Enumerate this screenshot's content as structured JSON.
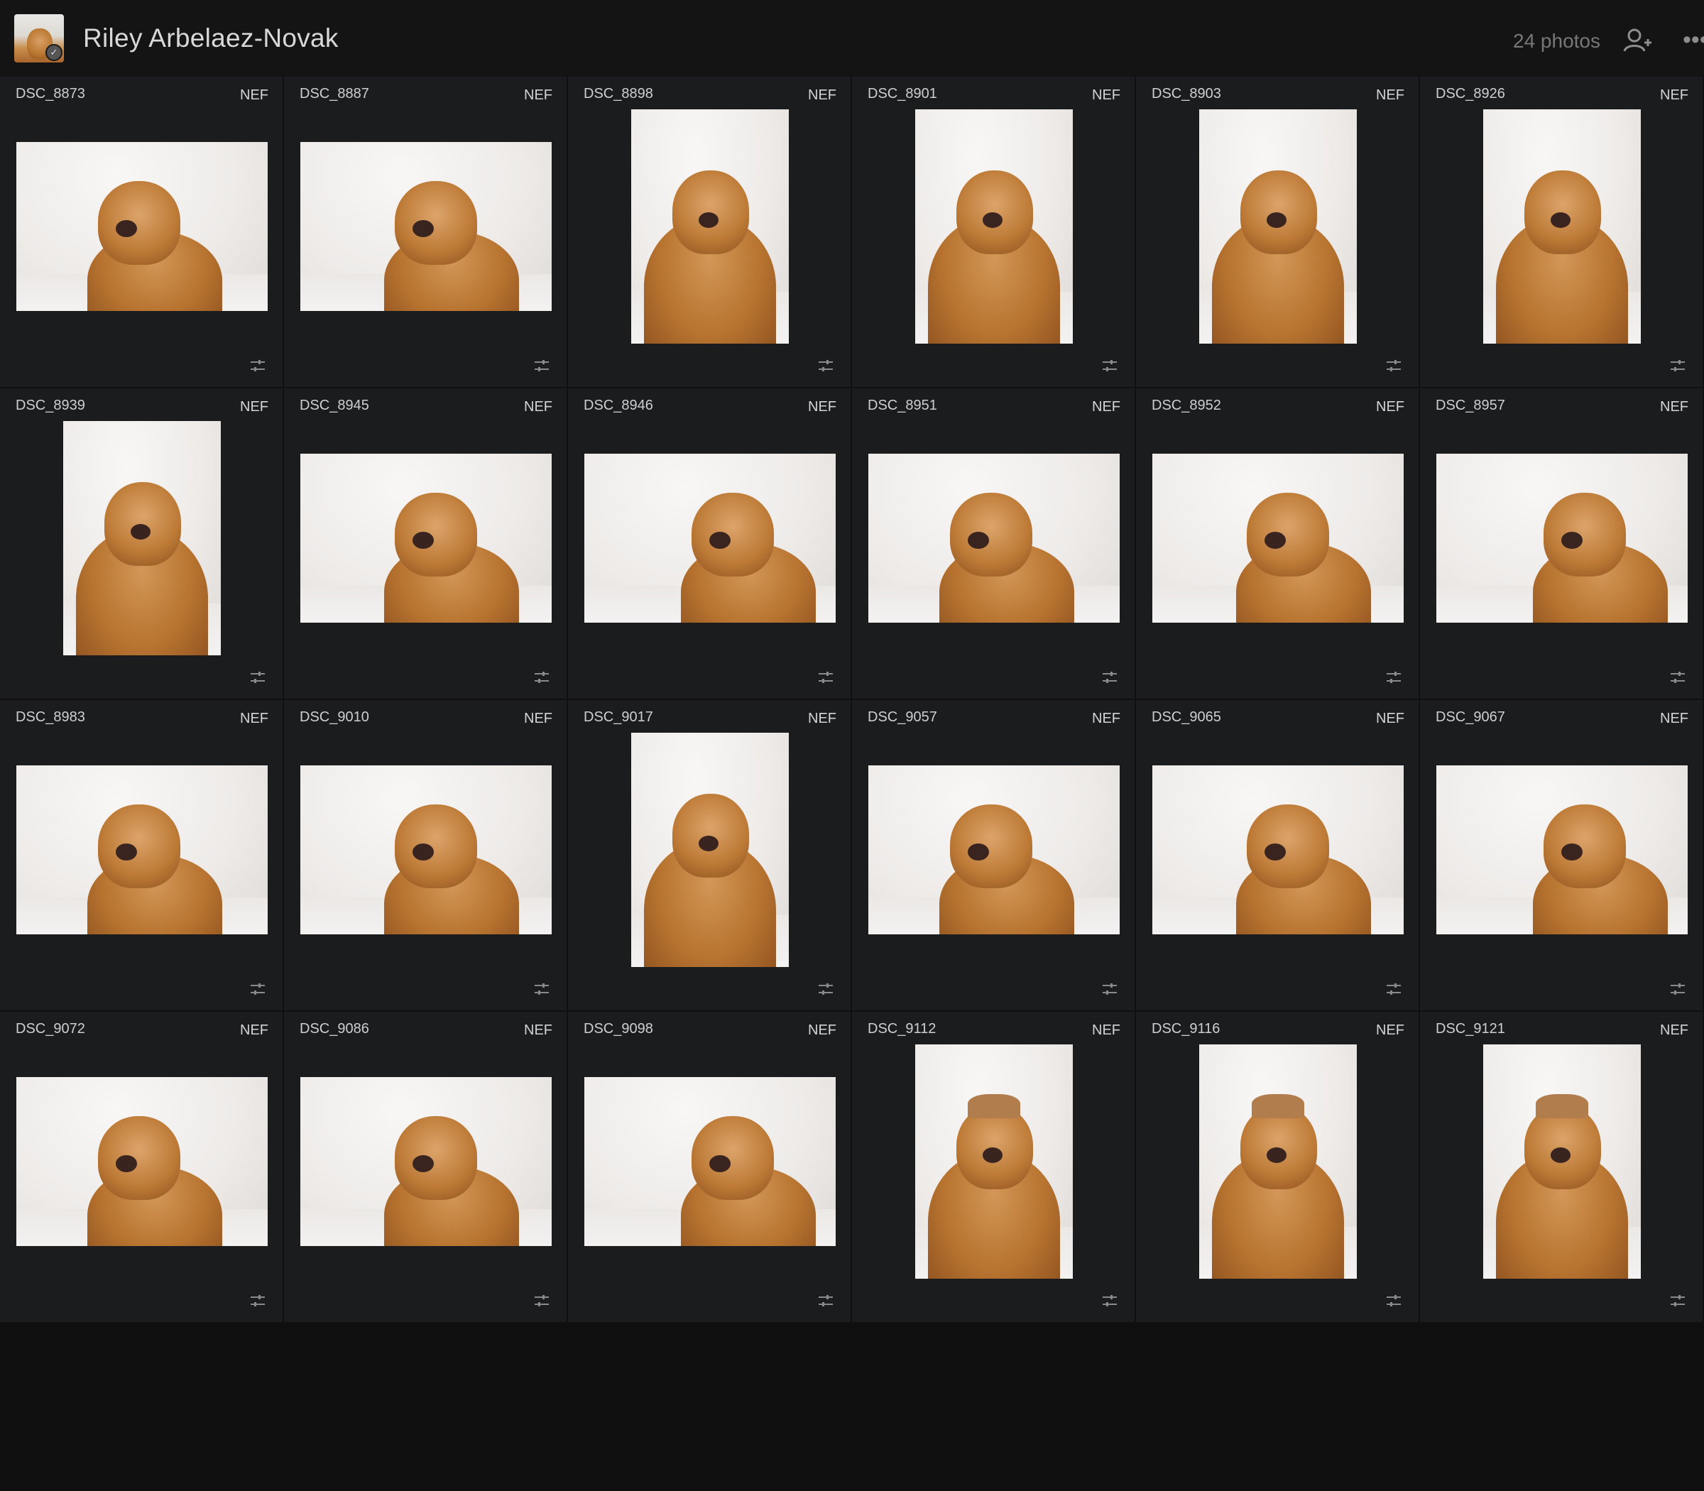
{
  "header": {
    "owner_name": "Riley Arbelaez-Novak",
    "photo_count": "24 photos",
    "more_label": "•••"
  },
  "colors": {
    "background": "#151516",
    "cell": "#1b1c1e",
    "text": "#d4d4d4",
    "muted": "#777777",
    "dog": "#b7732f"
  },
  "icons": {
    "share": "share-people-icon",
    "more": "more-icon",
    "adjust": "sliders-icon"
  },
  "photos": [
    {
      "filename": "DSC_8873",
      "format": "NEF",
      "orientation": "landscape"
    },
    {
      "filename": "DSC_8887",
      "format": "NEF",
      "orientation": "landscape"
    },
    {
      "filename": "DSC_8898",
      "format": "NEF",
      "orientation": "portrait"
    },
    {
      "filename": "DSC_8901",
      "format": "NEF",
      "orientation": "portrait"
    },
    {
      "filename": "DSC_8903",
      "format": "NEF",
      "orientation": "portrait"
    },
    {
      "filename": "DSC_8926",
      "format": "NEF",
      "orientation": "portrait"
    },
    {
      "filename": "DSC_8939",
      "format": "NEF",
      "orientation": "portrait"
    },
    {
      "filename": "DSC_8945",
      "format": "NEF",
      "orientation": "landscape"
    },
    {
      "filename": "DSC_8946",
      "format": "NEF",
      "orientation": "landscape"
    },
    {
      "filename": "DSC_8951",
      "format": "NEF",
      "orientation": "landscape"
    },
    {
      "filename": "DSC_8952",
      "format": "NEF",
      "orientation": "landscape"
    },
    {
      "filename": "DSC_8957",
      "format": "NEF",
      "orientation": "landscape"
    },
    {
      "filename": "DSC_8983",
      "format": "NEF",
      "orientation": "landscape"
    },
    {
      "filename": "DSC_9010",
      "format": "NEF",
      "orientation": "landscape"
    },
    {
      "filename": "DSC_9017",
      "format": "NEF",
      "orientation": "portrait"
    },
    {
      "filename": "DSC_9057",
      "format": "NEF",
      "orientation": "landscape"
    },
    {
      "filename": "DSC_9065",
      "format": "NEF",
      "orientation": "landscape"
    },
    {
      "filename": "DSC_9067",
      "format": "NEF",
      "orientation": "landscape"
    },
    {
      "filename": "DSC_9072",
      "format": "NEF",
      "orientation": "landscape"
    },
    {
      "filename": "DSC_9086",
      "format": "NEF",
      "orientation": "landscape"
    },
    {
      "filename": "DSC_9098",
      "format": "NEF",
      "orientation": "landscape"
    },
    {
      "filename": "DSC_9112",
      "format": "NEF",
      "orientation": "portrait",
      "hat": true
    },
    {
      "filename": "DSC_9116",
      "format": "NEF",
      "orientation": "portrait",
      "hat": true
    },
    {
      "filename": "DSC_9121",
      "format": "NEF",
      "orientation": "portrait",
      "hat": true
    }
  ]
}
